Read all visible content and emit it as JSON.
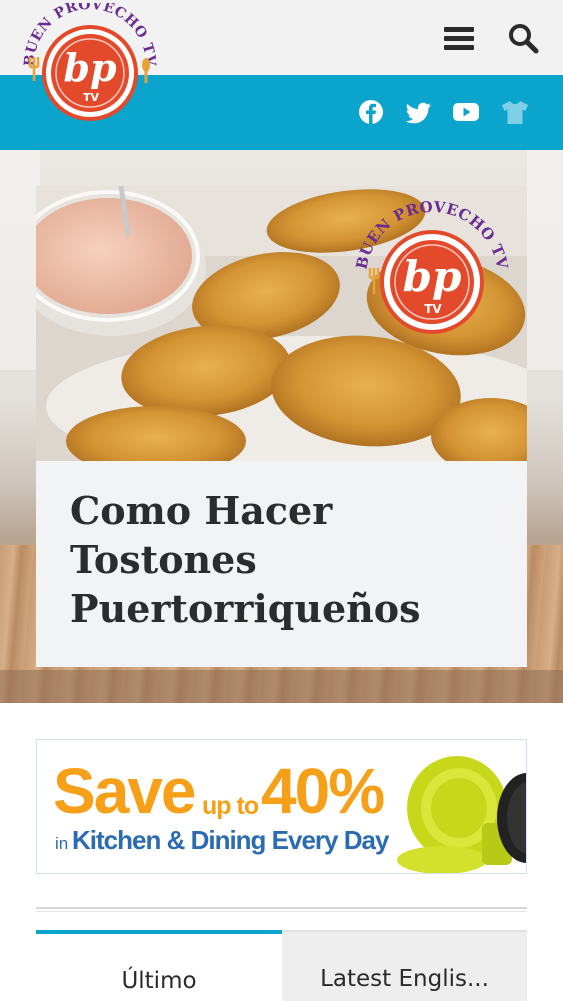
{
  "header": {
    "logo_arc_text": "BUEN PROVECHO TV",
    "logo_mark": "bp",
    "logo_sub": "TV",
    "menu_icon": "hamburger-menu-icon",
    "search_icon": "search-icon",
    "social": [
      "facebook-icon",
      "twitter-icon",
      "youtube-icon",
      "tshirt-icon"
    ]
  },
  "hero": {
    "title": "Como Hacer Tostones Puertorriqueños",
    "watermark_arc_text": "BUEN PROVECHO TV",
    "watermark_mark": "bp",
    "watermark_sub": "TV"
  },
  "ad": {
    "save": "Save",
    "up_to": "up to",
    "percent": "40%",
    "in": "in",
    "line2": "Kitchen & Dining Every Day"
  },
  "tabs": [
    {
      "label": "Último"
    },
    {
      "label": "Latest Englis..."
    }
  ],
  "colors": {
    "brand_blue": "#0aa4cc",
    "logo_red": "#e24a2b",
    "logo_purple": "#6a2c91",
    "ad_orange": "#f6a01a",
    "ad_blue": "#2a6bb2"
  }
}
